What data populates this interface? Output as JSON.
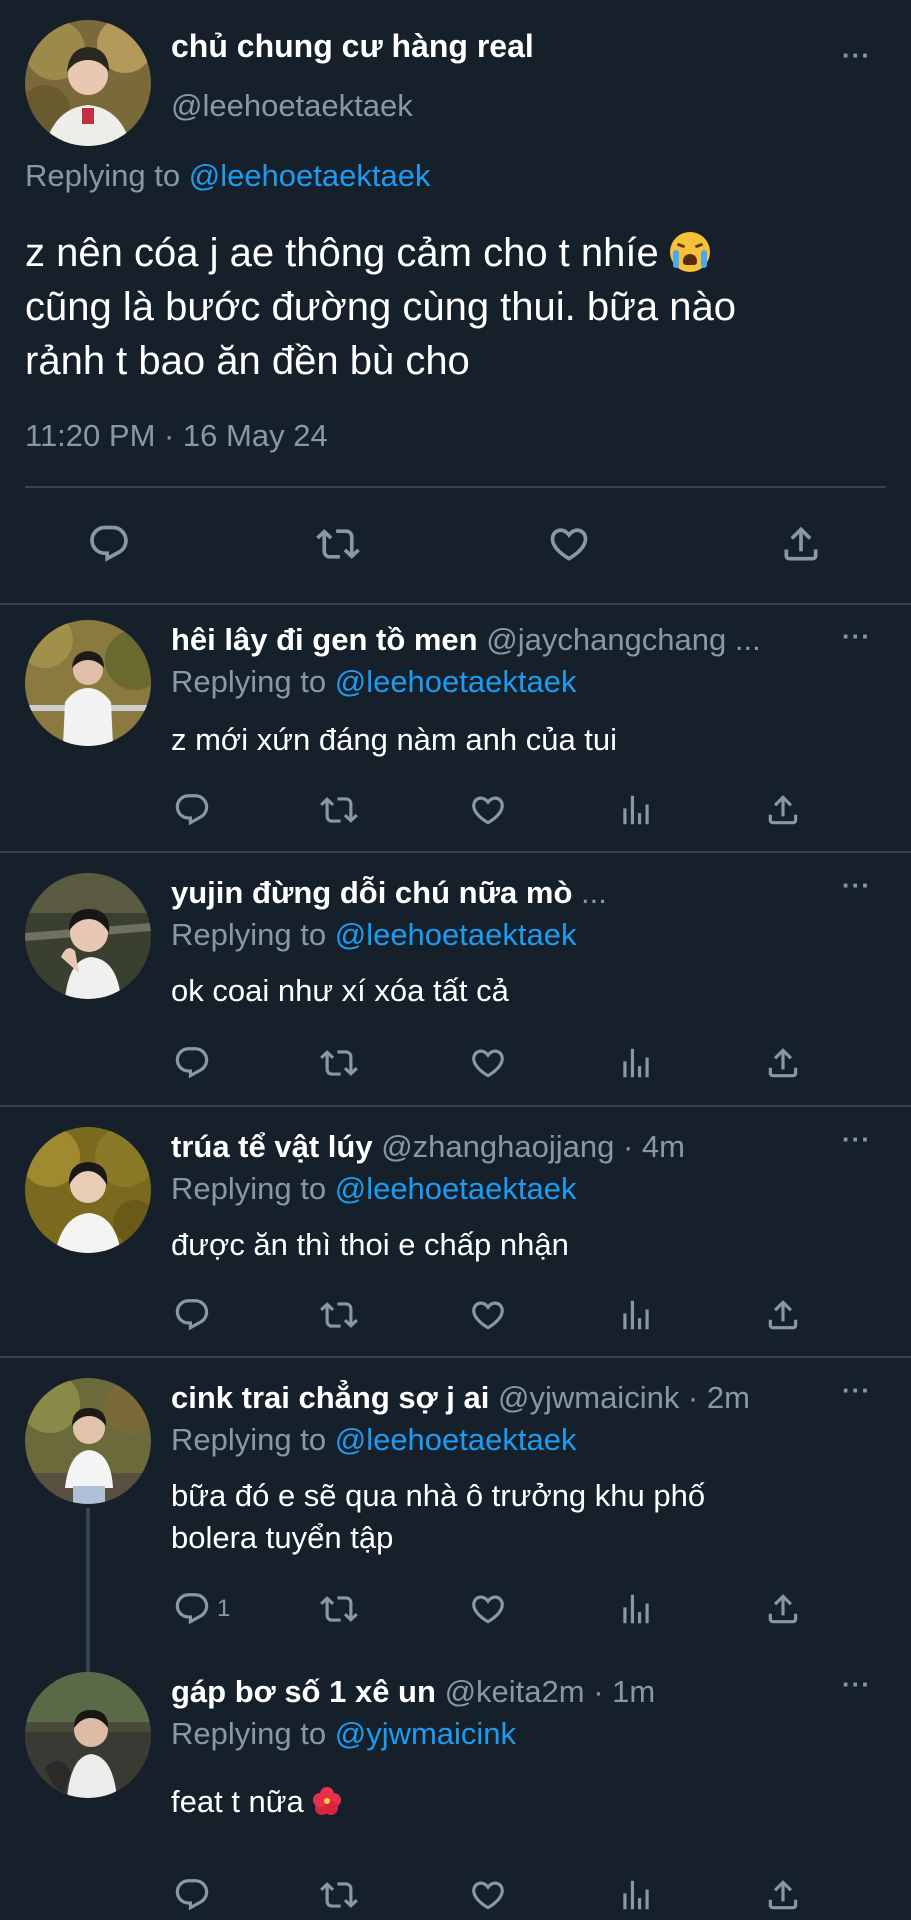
{
  "main_tweet": {
    "name": "chủ chung cư hàng real",
    "handle": "@leehoetaektaek",
    "replying_prefix": "Replying to",
    "replying_to": "@leehoetaektaek",
    "text_line1": "z nên cóa j ae thông cảm cho t nhíe",
    "text_line2": "cũng là bước đường cùng thui. bữa nào",
    "text_line3": "rảnh t bao ăn đền bù cho",
    "timestamp": "11:20 PM · 16 May 24",
    "more": "···"
  },
  "replies": [
    {
      "name": "hêi lây đi gen tồ men",
      "meta": "@jaychangchang ...",
      "replying_prefix": "Replying to",
      "replying_to": "@leehoetaektaek",
      "text": "z mới xứn đáng nàm anh của tui",
      "reply_count": "",
      "more": "···"
    },
    {
      "name": "yujin đừng dỗi chú nữa mò",
      "meta": "...",
      "replying_prefix": "Replying to",
      "replying_to": "@leehoetaektaek",
      "text": "ok coai như xí xóa tất cả",
      "reply_count": "",
      "more": "···"
    },
    {
      "name": "trúa tể vật lúy",
      "meta": "@zhanghaojjang · 4m",
      "replying_prefix": "Replying to",
      "replying_to": "@leehoetaektaek",
      "text": "được ăn thì thoi e chấp nhận",
      "reply_count": "",
      "more": "···"
    },
    {
      "name": "cink trai chẳng sợ j ai",
      "meta": "@yjwmaicink · 2m",
      "replying_prefix": "Replying to",
      "replying_to": "@leehoetaektaek",
      "text_line1": "bữa đó e sẽ qua nhà ô trưởng khu phố",
      "text_line2": "bolera tuyển tập",
      "reply_count": "1",
      "more": "···"
    },
    {
      "name": "gáp bơ số 1 xê un",
      "meta": "@keita2m · 1m",
      "replying_prefix": "Replying to",
      "replying_to": "@yjwmaicink",
      "text": "feat t nữa",
      "reply_count": "",
      "more": "···"
    }
  ],
  "icons": {
    "reply": "reply-icon",
    "retweet": "retweet-icon",
    "like": "like-icon",
    "analytics": "analytics-icon",
    "share": "share-icon"
  },
  "colors": {
    "background": "#15202b",
    "secondary_text": "#8899a6",
    "link": "#1d9bf0",
    "divider": "#38444d"
  }
}
